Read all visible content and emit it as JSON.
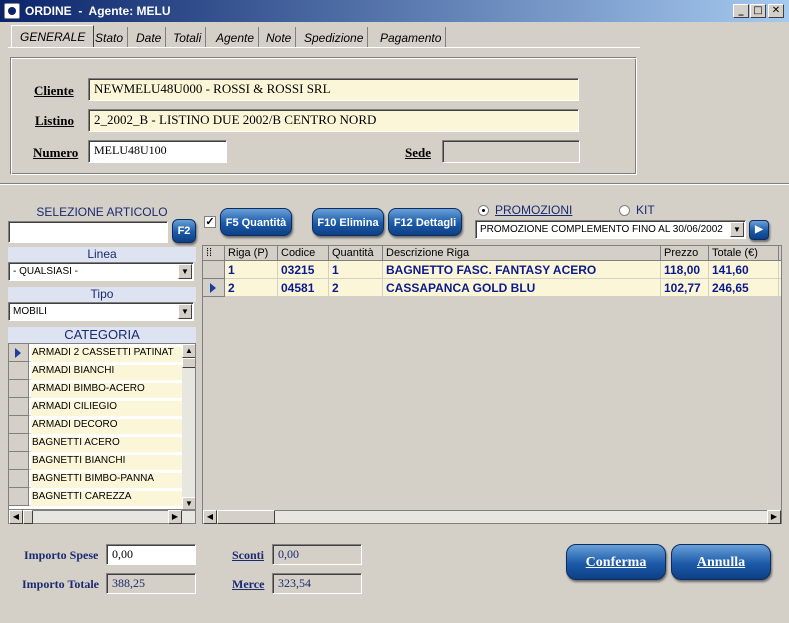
{
  "window": {
    "title": "ORDINE  -  Agente: MELU",
    "minimize": "_",
    "maximize": "□",
    "close": "✕"
  },
  "tabs": [
    "GENERALE",
    "Stato",
    "Date",
    "Totali",
    "Agente",
    "Note",
    "Spedizione",
    "Pagamento"
  ],
  "header": {
    "cliente_label": "Cliente",
    "cliente_value": "NEWMELU48U000 - ROSSI & ROSSI SRL",
    "listino_label": "Listino",
    "listino_value": "2_2002_B - LISTINO DUE 2002/B CENTRO NORD",
    "numero_label": "Numero",
    "numero_value": "MELU48U100",
    "sede_label": "Sede",
    "sede_value": ""
  },
  "left": {
    "selezione_label": "SELEZIONE ARTICOLO",
    "selezione_value": "",
    "f2_label": "F2",
    "linea_label": "Linea",
    "linea_value": "- QUALSIASI -",
    "tipo_label": "Tipo",
    "tipo_value": "MOBILI",
    "categoria_label": "CATEGORIA",
    "categories": [
      "ARMADI  2 CASSETTI PATINAT",
      "ARMADI  BIANCHI",
      "ARMADI  BIMBO-ACERO",
      "ARMADI  CILIEGIO",
      "ARMADI DECORO",
      "BAGNETTI ACERO",
      "BAGNETTI BIANCHI",
      "BAGNETTI BIMBO-PANNA",
      "BAGNETTI CAREZZA"
    ]
  },
  "toolbar": {
    "f5_label": "F5 Quantità",
    "f5_checked": true,
    "f10_label": "F10 Elimina",
    "f12_label": "F12 Dettagli",
    "promozioni_label": "PROMOZIONI",
    "kit_label": "KIT",
    "promo_value": "PROMOZIONE COMPLEMENTO FINO AL 30/06/2002"
  },
  "grid": {
    "columns": [
      "Riga (P)",
      "Codice",
      "Quantità",
      "Descrizione Riga",
      "Prezzo",
      "Totale (€)"
    ],
    "rows": [
      [
        "1",
        "03215",
        "1",
        "BAGNETTO FASC. FANTASY ACERO",
        "118,00",
        "141,60"
      ],
      [
        "2",
        "04581",
        "2",
        "CASSAPANCA GOLD BLU",
        "102,77",
        "246,65"
      ]
    ]
  },
  "footer": {
    "importo_spese_label": "Importo Spese",
    "importo_spese_value": "0,00",
    "importo_totale_label": "Importo Totale",
    "importo_totale_value": "388,25",
    "sconti_label": "Sconti",
    "sconti_value": "0,00",
    "merce_label": "Merce",
    "merce_value": "323,54",
    "conferma_label": "Conferma",
    "annulla_label": "Annulla"
  }
}
